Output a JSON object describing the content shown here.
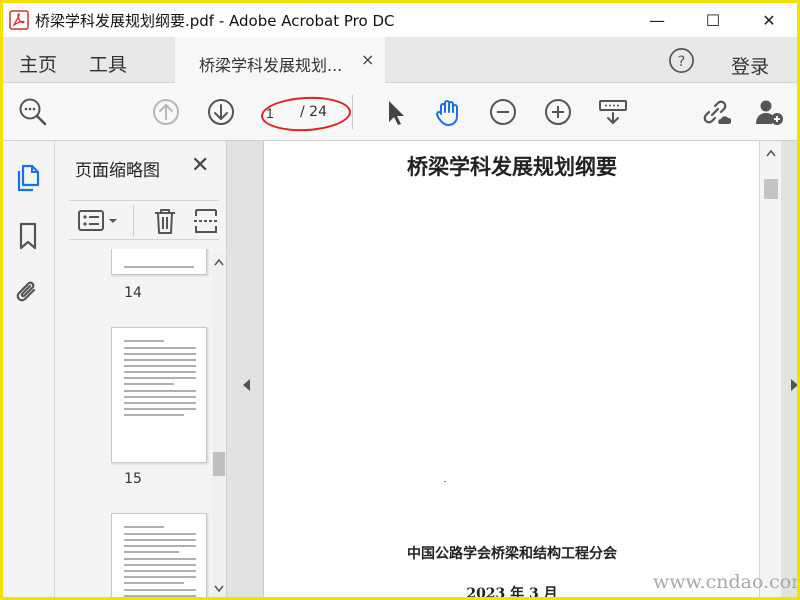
{
  "window": {
    "title": "桥梁学科发展规划纲要.pdf - Adobe Acrobat Pro DC",
    "minimize": "—",
    "maximize": "☐",
    "close": "✕"
  },
  "tabs": {
    "home": "主页",
    "tools": "工具",
    "document": "桥梁学科发展规划...",
    "close": "×",
    "help": "?",
    "login": "登录"
  },
  "toolbar": {
    "current_page": "1",
    "total_pages": "/ 24",
    "icons": [
      "search-comment-icon",
      "prev-page-icon",
      "next-page-icon",
      "select-cursor-icon",
      "hand-tool-icon",
      "zoom-out-icon",
      "zoom-in-icon",
      "fit-page-icon",
      "share-link-icon",
      "add-user-icon"
    ]
  },
  "thumbnail_panel": {
    "title": "页面缩略图",
    "close": "✕",
    "pages": [
      {
        "label": "14"
      },
      {
        "label": "15"
      }
    ]
  },
  "document": {
    "title": "桥梁学科发展规划纲要",
    "organization": "中国公路学会桥梁和结构工程分会",
    "date": "2023 年 3 月"
  },
  "watermark": "www.cndao.com",
  "colors": {
    "accent_blue": "#1473e6",
    "annotation_red": "#e52020",
    "frame_yellow": "#f2e200"
  }
}
